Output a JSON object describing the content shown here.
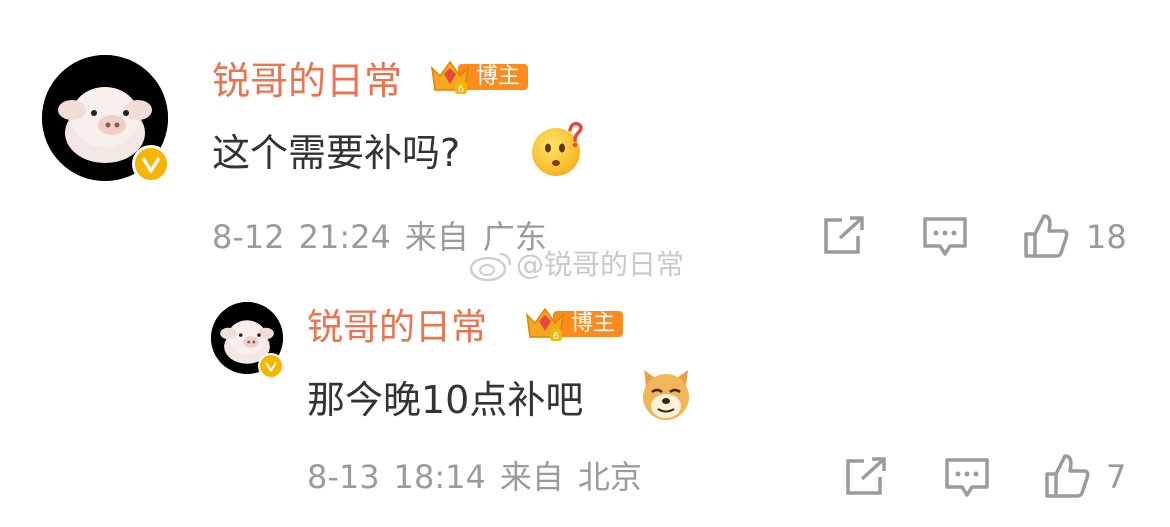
{
  "comment": {
    "username": "锐哥的日常",
    "badge_label": "博主",
    "badge_level": "6",
    "text": "这个需要补吗?",
    "emoji_icon": "confused-face-emoji",
    "date": "8-12",
    "time": "21:24",
    "from_label": "来自",
    "location": "广东",
    "like_count": "18"
  },
  "reply": {
    "username": "锐哥的日常",
    "badge_label": "博主",
    "badge_level": "6",
    "text": "那今晚10点补吧",
    "emoji_icon": "doge-emoji",
    "date": "8-13",
    "time": "18:14",
    "from_label": "来自",
    "location": "北京",
    "like_count": "7"
  },
  "watermark": {
    "text": "@锐哥的日常"
  },
  "colors": {
    "username": "#eb7350",
    "badge": "#ff8a1e",
    "verified": "#f7b500",
    "meta": "#9b9b9b",
    "text": "#333333"
  }
}
